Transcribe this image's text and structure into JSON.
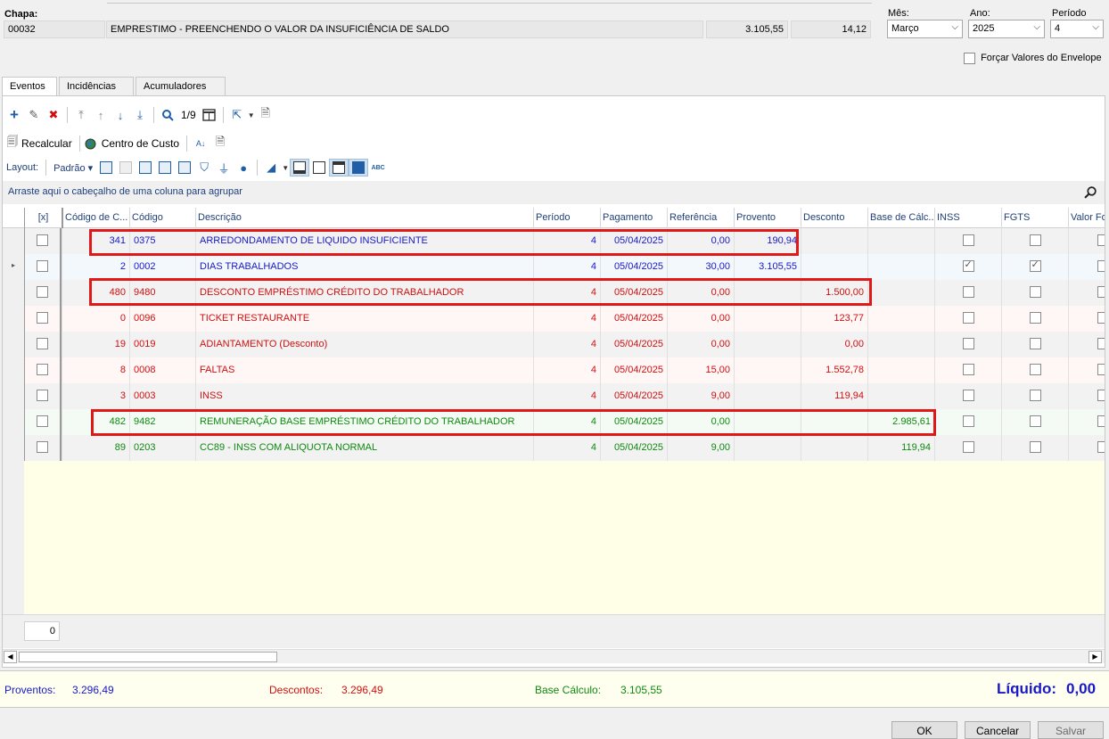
{
  "header": {
    "chapa_label": "Chapa:",
    "chapa": "00032",
    "nome": "EMPRESTIMO - PREENCHENDO O VALOR DA INSUFICIÊNCIA DE SALDO",
    "salario": "3.105,55",
    "horas": "14,12",
    "mes_label": "Mês:",
    "mes": "Março",
    "ano_label": "Ano:",
    "ano": "2025",
    "periodo_label": "Período",
    "periodo": "4",
    "forcar_label": "Forçar Valores do Envelope"
  },
  "tabs": [
    "Eventos",
    "Incidências",
    "Acumuladores"
  ],
  "toolbar": {
    "counter": "1/9",
    "recalcular": "Recalcular",
    "centro_custo": "Centro de Custo",
    "layout_label": "Layout:",
    "layout_value": "Padrão"
  },
  "grid": {
    "group_hint": "Arraste aqui o cabeçalho de uma coluna para agrupar",
    "columns": [
      "[x]",
      "Código de C...",
      "Código",
      "Descrição",
      "Período",
      "Pagamento",
      "Referência",
      "Provento",
      "Desconto",
      "Base de Cálc...",
      "INSS",
      "FGTS",
      "Valor Fo"
    ],
    "rows": [
      {
        "cod_c": "341",
        "codigo": "0375",
        "descricao": "ARREDONDAMENTO DE LIQUIDO INSUFICIENTE",
        "periodo": "4",
        "pagamento": "05/04/2025",
        "referencia": "0,00",
        "provento": "190,94",
        "desconto": "",
        "base": "",
        "inss": false,
        "fgts": false,
        "color": "#1818c8",
        "bg": "#f2f2f2",
        "current": false
      },
      {
        "cod_c": "2",
        "codigo": "0002",
        "descricao": "DIAS TRABALHADOS",
        "periodo": "4",
        "pagamento": "05/04/2025",
        "referencia": "30,00",
        "provento": "3.105,55",
        "desconto": "",
        "base": "",
        "inss": true,
        "fgts": true,
        "color": "#1818c8",
        "bg": "#f3f8fd",
        "current": true
      },
      {
        "cod_c": "480",
        "codigo": "9480",
        "descricao": "DESCONTO EMPRÉSTIMO CRÉDITO DO TRABALHADOR",
        "periodo": "4",
        "pagamento": "05/04/2025",
        "referencia": "0,00",
        "provento": "",
        "desconto": "1.500,00",
        "base": "",
        "inss": false,
        "fgts": false,
        "color": "#d01010",
        "bg": "#f2f2f2",
        "current": false
      },
      {
        "cod_c": "0",
        "codigo": "0096",
        "descricao": "TICKET RESTAURANTE",
        "periodo": "4",
        "pagamento": "05/04/2025",
        "referencia": "0,00",
        "provento": "",
        "desconto": "123,77",
        "base": "",
        "inss": false,
        "fgts": false,
        "color": "#d01010",
        "bg": "#fff6f6",
        "current": false
      },
      {
        "cod_c": "19",
        "codigo": "0019",
        "descricao": "ADIANTAMENTO (Desconto)",
        "periodo": "4",
        "pagamento": "05/04/2025",
        "referencia": "0,00",
        "provento": "",
        "desconto": "0,00",
        "base": "",
        "inss": false,
        "fgts": false,
        "color": "#d01010",
        "bg": "#f2f2f2",
        "current": false
      },
      {
        "cod_c": "8",
        "codigo": "0008",
        "descricao": "FALTAS",
        "periodo": "4",
        "pagamento": "05/04/2025",
        "referencia": "15,00",
        "provento": "",
        "desconto": "1.552,78",
        "base": "",
        "inss": false,
        "fgts": false,
        "color": "#d01010",
        "bg": "#fff6f6",
        "current": false
      },
      {
        "cod_c": "3",
        "codigo": "0003",
        "descricao": "INSS",
        "periodo": "4",
        "pagamento": "05/04/2025",
        "referencia": "9,00",
        "provento": "",
        "desconto": "119,94",
        "base": "",
        "inss": false,
        "fgts": false,
        "color": "#d01010",
        "bg": "#f2f2f2",
        "current": false
      },
      {
        "cod_c": "482",
        "codigo": "9482",
        "descricao": "REMUNERAÇÃO BASE EMPRÉSTIMO CRÉDITO DO TRABALHADOR",
        "periodo": "4",
        "pagamento": "05/04/2025",
        "referencia": "0,00",
        "provento": "",
        "desconto": "",
        "base": "2.985,61",
        "inss": false,
        "fgts": false,
        "color": "#0e8a0e",
        "bg": "#f4fbf4",
        "current": false
      },
      {
        "cod_c": "89",
        "codigo": "0203",
        "descricao": "CC89 - INSS COM ALIQUOTA NORMAL",
        "periodo": "4",
        "pagamento": "05/04/2025",
        "referencia": "9,00",
        "provento": "",
        "desconto": "",
        "base": "119,94",
        "inss": false,
        "fgts": false,
        "color": "#0e8a0e",
        "bg": "#f2f2f2",
        "current": false
      }
    ],
    "footer_count": "0"
  },
  "totals": {
    "proventos_label": "Proventos:",
    "proventos": "3.296,49",
    "descontos_label": "Descontos:",
    "descontos": "3.296,49",
    "base_label": "Base Cálculo:",
    "base": "3.105,55",
    "liquido_label": "Líquido:",
    "liquido": "0,00"
  },
  "buttons": {
    "ok": "OK",
    "cancelar": "Cancelar",
    "salvar": "Salvar"
  },
  "colors": {
    "blue": "#1818c8",
    "red": "#d01010",
    "green": "#0e8a0e",
    "highlight": "#e01818"
  },
  "highlighted_rows": [
    "341",
    "480",
    "482"
  ]
}
